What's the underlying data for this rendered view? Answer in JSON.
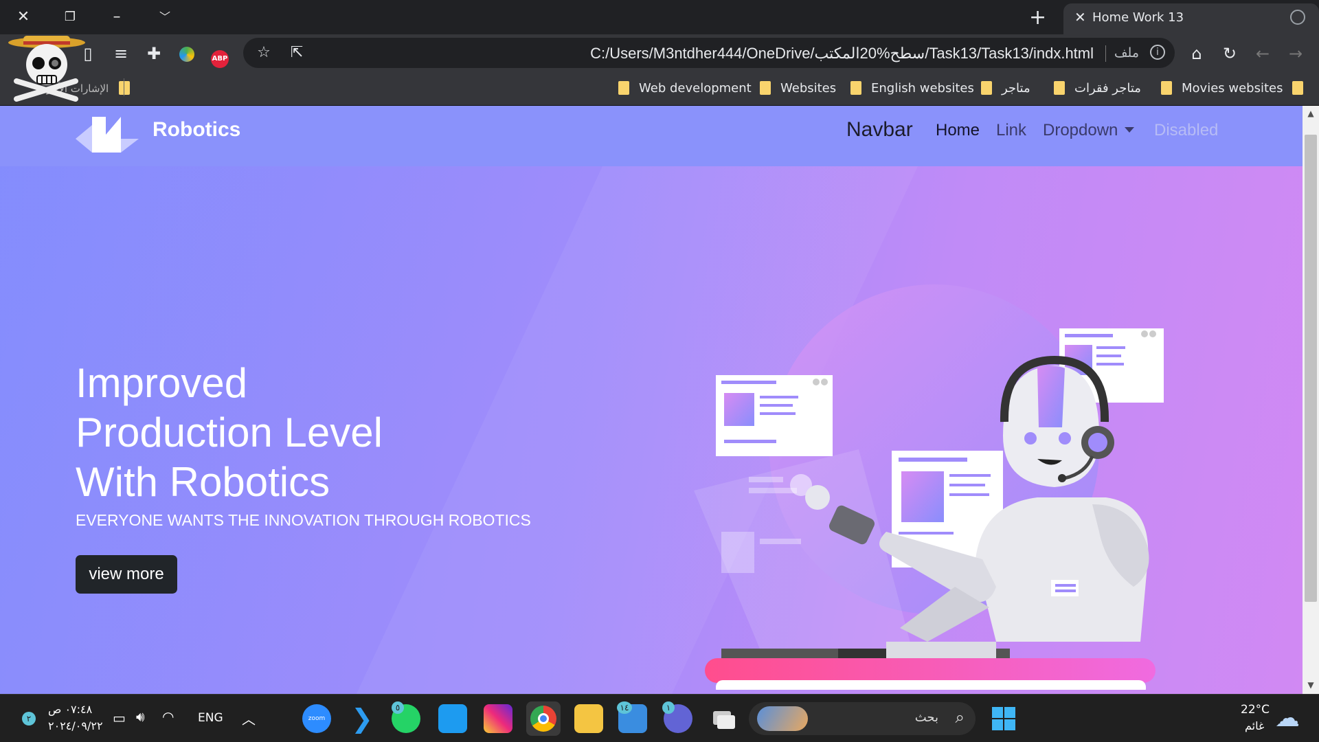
{
  "browser": {
    "tab_title": "Home Work 13",
    "url": "C:/Users/M3ntdher444/OneDrive/سطح%20المكتب/Task13/Task13/indx.html",
    "url_scheme_label": "ملف",
    "profile_label": "الإشارات الأخرى",
    "bookmarks": [
      "Web development",
      "Websites",
      "English websites",
      "متاجر",
      "متاجر فقرات",
      "Movies websites"
    ]
  },
  "page": {
    "brand": "Robotics",
    "navbar": {
      "title": "Navbar",
      "links": [
        "Home",
        "Link",
        "Dropdown",
        "Disabled"
      ]
    },
    "hero": {
      "title_lines": [
        "Improved",
        "Production Level",
        "With Robotics"
      ],
      "subtitle": "EVERYONE WANTS THE INNOVATION THROUGH ROBOTICS",
      "button": "view more"
    },
    "colors": {
      "accent": "#8a92fb",
      "hero_end": "#d189f3",
      "button_bg": "#212529",
      "base_bar": "#ff4d8d"
    }
  },
  "taskbar": {
    "time": "٠٧:٤٨ ص",
    "date": "٢٠٢٤/٠٩/٢٢",
    "notification_count": "٢",
    "language": "ENG",
    "search_placeholder": "بحث",
    "weather_temp": "22°C",
    "weather_desc": "غائم",
    "whatsapp_badge": "٥",
    "mail_badge": "١٤",
    "chat_badge": "١",
    "apps": [
      "zoom-icon",
      "vscode-icon",
      "whatsapp-icon",
      "twitter-icon",
      "instagram-icon",
      "chrome-icon",
      "file-explorer-icon",
      "mail-icon",
      "teams-icon",
      "task-view-icon"
    ]
  }
}
